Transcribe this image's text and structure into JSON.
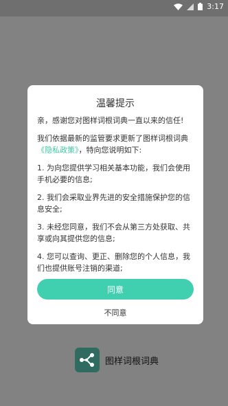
{
  "status_bar": {
    "time": "3:17"
  },
  "dialog": {
    "title": "温馨提示",
    "greeting": "亲，感谢您对图样词根词典一直以来的信任!",
    "intro_prefix": "我们依据最新的监管要求更新了图样词根词典",
    "privacy_link": "《隐私政策》",
    "intro_suffix": "，特向您说明如下:",
    "items": [
      "1. 为向您提供学习相关基本功能，我们会使用手机必要的信息;",
      "2. 我们会采取业界先进的安全措施保护您的信息安全;",
      "3. 未经您同意，我们不会从第三方处获取、共享或向其提供您的信息;",
      "4. 您可以查询、更正、删除您的个人信息，我们也提供账号注销的渠道;"
    ],
    "agree_label": "同意",
    "disagree_label": "不同意"
  },
  "brand": {
    "name": "图样词根词典"
  },
  "colors": {
    "accent": "#40d0b0",
    "link": "#3ec9a5",
    "logo_bg": "#2f6b61"
  }
}
